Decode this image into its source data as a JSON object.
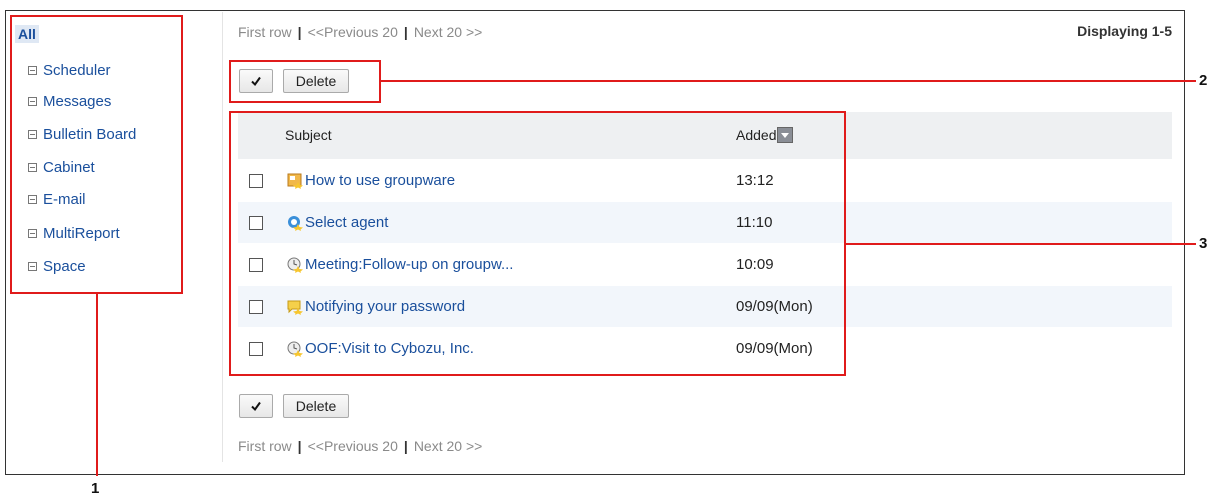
{
  "sidebar": {
    "all_label": "All",
    "items": [
      {
        "label": "Scheduler"
      },
      {
        "label": "Messages"
      },
      {
        "label": "Bulletin Board"
      },
      {
        "label": "Cabinet"
      },
      {
        "label": "E-mail"
      },
      {
        "label": "MultiReport"
      },
      {
        "label": "Space"
      }
    ]
  },
  "pager": {
    "first": "First row",
    "prev": "<<Previous 20",
    "next": "Next 20 >>",
    "separator": "|",
    "displaying": "Displaying 1-5"
  },
  "toolbar": {
    "check_all_icon": "checkmark-icon",
    "delete_label": "Delete"
  },
  "table": {
    "col_subject": "Subject",
    "col_added": "Added",
    "sort_icon": "sort-desc-icon",
    "rows": [
      {
        "subject": "How to use groupware",
        "added": "13:12",
        "icon": "bulletin-icon"
      },
      {
        "subject": "Select agent",
        "added": "11:10",
        "icon": "refresh-icon"
      },
      {
        "subject": "Meeting:Follow-up on groupw...",
        "added": "10:09",
        "icon": "clock-icon"
      },
      {
        "subject": "Notifying your password",
        "added": "09/09(Mon)",
        "icon": "message-icon"
      },
      {
        "subject": "OOF:Visit to Cybozu, Inc.",
        "added": "09/09(Mon)",
        "icon": "clock-icon"
      }
    ]
  },
  "callouts": {
    "one": "1",
    "two": "2",
    "three": "3"
  },
  "colors": {
    "link": "#1a4f9c",
    "highlight": "#e01b1b"
  }
}
